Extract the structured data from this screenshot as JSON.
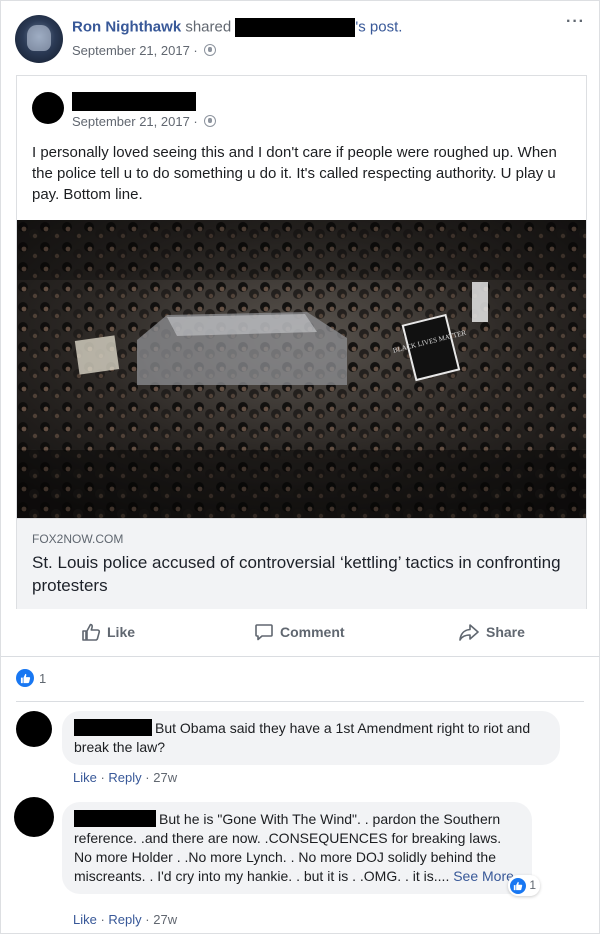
{
  "post": {
    "author": "Ron Nighthawk",
    "shared_word": "shared",
    "post_suffix": "'s post.",
    "date": "September 21, 2017 ·",
    "more_glyph": "···"
  },
  "shared_post": {
    "date": "September 21, 2017 ·",
    "text": "I personally loved seeing this and I don't care if people were roughed up. When the police tell u to do something u do it. It's called respecting authority. U play u pay. Bottom line.",
    "link_domain": "FOX2NOW.COM",
    "link_title": "St. Louis police accused of controversial ‘kettling’ tactics in confronting protesters",
    "photo_signs": [
      "BLACK LIVES MATTER"
    ]
  },
  "actions": {
    "like": "Like",
    "comment": "Comment",
    "share": "Share"
  },
  "reactions": {
    "count": "1"
  },
  "comments": [
    {
      "text": "But Obama said they have a 1st Amendment right to riot and break the law?",
      "like": "Like",
      "reply": "Reply",
      "time": "· 27w"
    },
    {
      "text": "But he is \"Gone With The Wind\". . pardon the Southern reference. .and there are now. .CONSEQUENCES for breaking laws. No more Holder . .No more Lynch. . No more DOJ solidly behind the miscreants. . I'd cry into my hankie. . but it is . .OMG. . it is....",
      "see_more": "See More",
      "like_count": "1",
      "like": "Like",
      "reply": "Reply",
      "time": "· 27w"
    }
  ],
  "colors": {
    "link": "#385898",
    "like_blue": "#1877f2",
    "muted": "#616770"
  }
}
